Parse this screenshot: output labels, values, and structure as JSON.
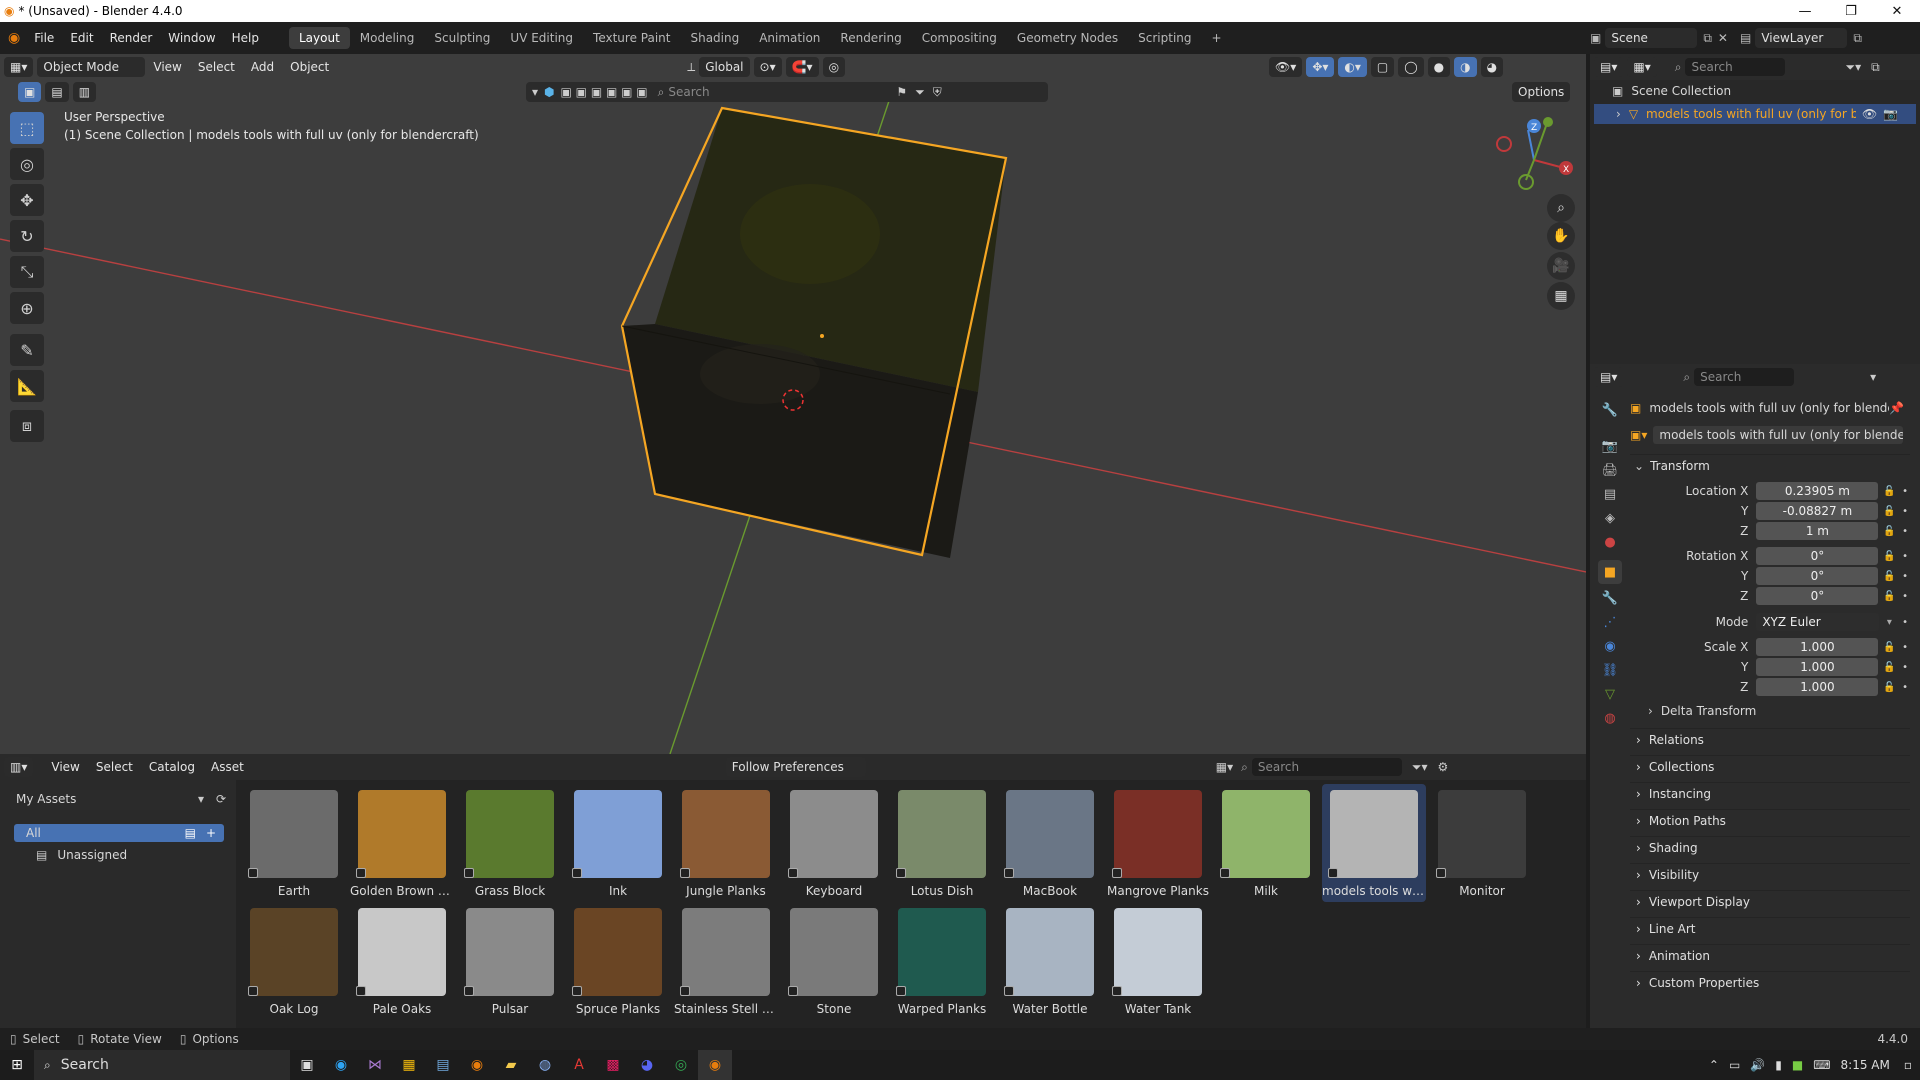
{
  "window": {
    "title": "* (Unsaved) - Blender 4.4.0"
  },
  "menus": [
    "File",
    "Edit",
    "Render",
    "Window",
    "Help"
  ],
  "workspaces": [
    "Layout",
    "Modeling",
    "Sculpting",
    "UV Editing",
    "Texture Paint",
    "Shading",
    "Animation",
    "Rendering",
    "Compositing",
    "Geometry Nodes",
    "Scripting"
  ],
  "active_workspace": "Layout",
  "scene": {
    "name": "Scene",
    "view_layer": "ViewLayer"
  },
  "viewport": {
    "mode": "Object Mode",
    "menus": [
      "View",
      "Select",
      "Add",
      "Object"
    ],
    "orientation": "Global",
    "search_placeholder": "Search",
    "options_label": "Options",
    "overlay_title": "User Perspective",
    "overlay_sub": "(1) Scene Collection | models tools with full uv (only for blendercraft)",
    "gizmo": {
      "x": "X",
      "y": "Y",
      "z": "Z"
    }
  },
  "outliner": {
    "search_placeholder": "Search",
    "root": "Scene Collection",
    "item": "models tools with full uv (only for bler"
  },
  "properties": {
    "search_placeholder": "Search",
    "object_name": "models tools with full uv (only for blender...",
    "data_name": "models tools with full uv (only for blendercraft)",
    "transform_label": "Transform",
    "location": {
      "label_x": "Location X",
      "x": "0.23905 m",
      "y": "-0.08827 m",
      "z": "1 m"
    },
    "rotation": {
      "label_x": "Rotation X",
      "x": "0°",
      "y": "0°",
      "z": "0°"
    },
    "mode_label": "Mode",
    "mode_value": "XYZ Euler",
    "scale": {
      "label_x": "Scale X",
      "x": "1.000",
      "y": "1.000",
      "z": "1.000"
    },
    "axis_y": "Y",
    "axis_z": "Z",
    "delta": "Delta Transform",
    "panels": [
      "Relations",
      "Collections",
      "Instancing",
      "Motion Paths",
      "Shading",
      "Visibility",
      "Viewport Display",
      "Line Art",
      "Animation",
      "Custom Properties"
    ]
  },
  "asset_browser": {
    "menus": [
      "View",
      "Select",
      "Catalog",
      "Asset"
    ],
    "follow": "Follow Preferences",
    "search_placeholder": "Search",
    "library": "My Assets",
    "catalog_all": "All",
    "catalog_unassigned": "Unassigned",
    "row1": [
      {
        "name": "Earth",
        "color": "#6b6b6b"
      },
      {
        "name": "Golden Brown Fri...",
        "color": "#b07a2a"
      },
      {
        "name": "Grass Block",
        "color": "#5a7a2e"
      },
      {
        "name": "Ink",
        "color": "#7f9fd6"
      },
      {
        "name": "Jungle Planks",
        "color": "#8a5a34"
      },
      {
        "name": "Keyboard",
        "color": "#8c8c8c"
      },
      {
        "name": "Lotus Dish",
        "color": "#7a8a6a"
      },
      {
        "name": "MacBook",
        "color": "#6a7686"
      },
      {
        "name": "Mangrove Planks",
        "color": "#7a2f26"
      },
      {
        "name": "Milk",
        "color": "#8fb46a"
      },
      {
        "name": "models tools with...",
        "color": "#b4b4b4"
      },
      {
        "name": "Monitor",
        "color": "#3c3c3c"
      }
    ],
    "row2": [
      {
        "name": "Oak Log",
        "color": "#5a4326"
      },
      {
        "name": "Pale Oaks",
        "color": "#c8c8c8"
      },
      {
        "name": "Pulsar",
        "color": "#8a8a8a"
      },
      {
        "name": "Spruce Planks",
        "color": "#6a4524"
      },
      {
        "name": "Stainless Stell Tr...",
        "color": "#7c7c7c"
      },
      {
        "name": "Stone",
        "color": "#7a7a7a"
      },
      {
        "name": "Warped Planks",
        "color": "#1f5a4f"
      },
      {
        "name": "Water Bottle",
        "color": "#a8b4c2"
      },
      {
        "name": "Water Tank",
        "color": "#c4ccd6"
      }
    ]
  },
  "statusbar": {
    "select": "Select",
    "rotate": "Rotate View",
    "options": "Options",
    "version": "4.4.0"
  },
  "taskbar": {
    "search": "Search",
    "time": "8:15 AM"
  },
  "colors": {
    "accent": "#4772b3",
    "selection_outline": "#f5a623",
    "x_axis": "#c0393b",
    "y_axis": "#6a9a2f"
  }
}
